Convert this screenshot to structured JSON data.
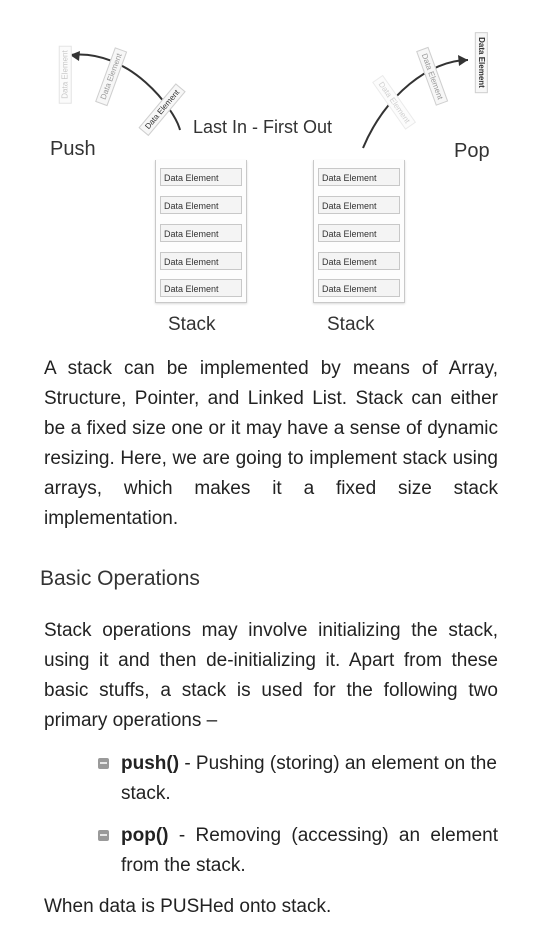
{
  "diagram": {
    "element_label": "Data Element",
    "push_label": "Push",
    "pop_label": "Pop",
    "lifo_label": "Last In - First Out",
    "stack_caption": "Stack",
    "left_stack": [
      "Data Element",
      "Data Element",
      "Data Element",
      "Data Element",
      "Data Element"
    ],
    "right_stack": [
      "Data Element",
      "Data Element",
      "Data Element",
      "Data Element",
      "Data Element"
    ]
  },
  "intro_paragraph": "A stack can be implemented by means of Array, Structure, Pointer, and Linked List. Stack can either be a fixed size one or it may have a sense of dynamic resizing. Here, we are going to implement stack using arrays, which makes it a fixed size stack implementation.",
  "section_heading": "Basic Operations",
  "operations_paragraph": "Stack operations may involve initializing the stack, using it and then de-initializing it. Apart from these basic stuffs, a stack is used for the following two primary operations –",
  "operations": [
    {
      "name": "push()",
      "description": " -  Pushing (storing) an element on the stack."
    },
    {
      "name": "pop()",
      "description": "  -   Removing (accessing) an element from the stack."
    }
  ],
  "closing_line": "When data is PUSHed onto stack."
}
